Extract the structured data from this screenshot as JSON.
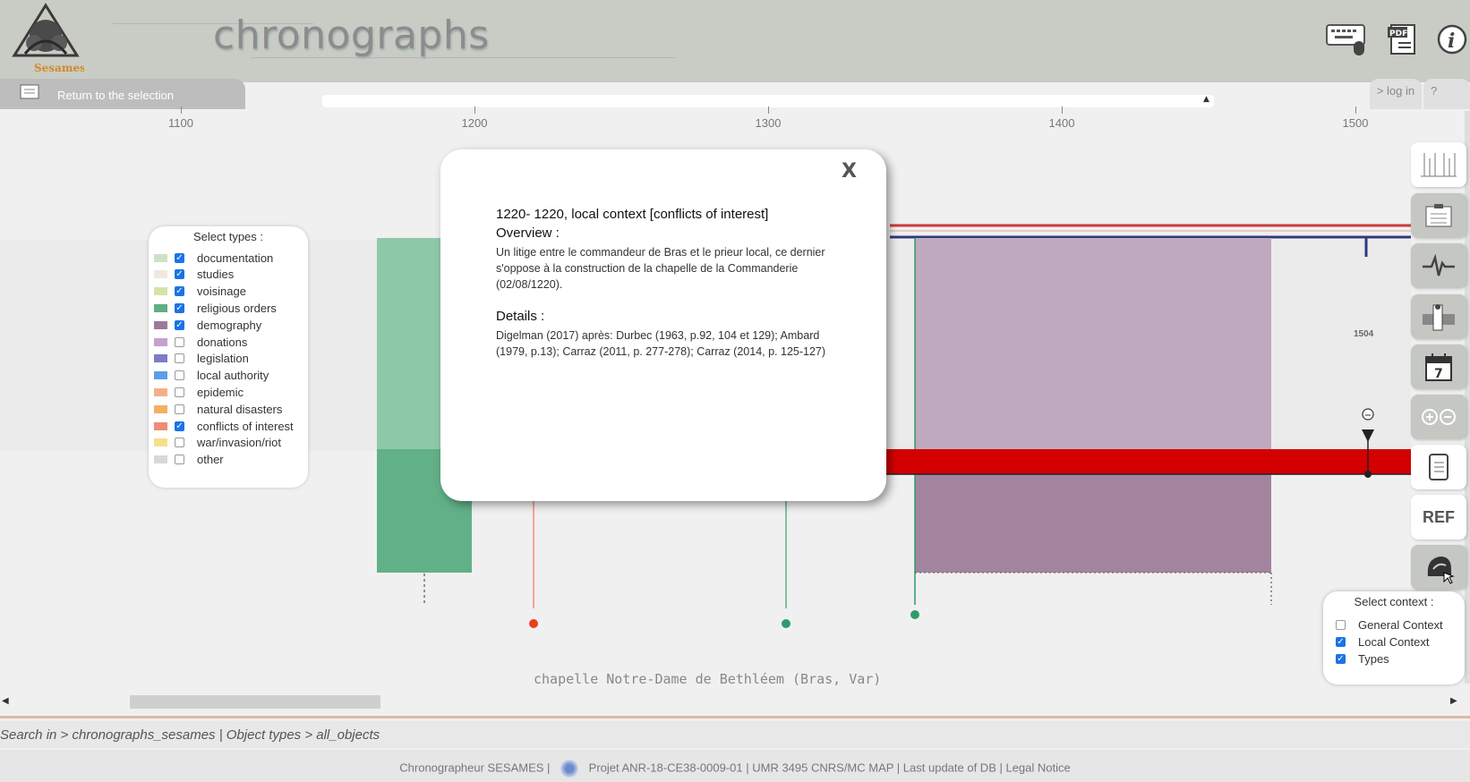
{
  "header": {
    "logo_text": "Sesames",
    "app_title": "chronographs",
    "return_label": "Return to the selection",
    "login_tab": "> log in",
    "help_tab": "?"
  },
  "axis": {
    "ticks": [
      "1100",
      "1200",
      "1300",
      "1400",
      "1500"
    ]
  },
  "types_panel": {
    "title": "Select types :",
    "items": [
      {
        "label": "documentation",
        "color": "#cfe2c8",
        "checked": true
      },
      {
        "label": "studies",
        "color": "#efe8e0",
        "checked": true
      },
      {
        "label": "voisinage",
        "color": "#d4e4a8",
        "checked": true
      },
      {
        "label": "religious orders",
        "color": "#5fae85",
        "checked": true
      },
      {
        "label": "demography",
        "color": "#9a7a9a",
        "checked": true
      },
      {
        "label": "donations",
        "color": "#c7a0cf",
        "checked": false
      },
      {
        "label": "legislation",
        "color": "#7c7cc6",
        "checked": false
      },
      {
        "label": "local authority",
        "color": "#5b9ee8",
        "checked": false
      },
      {
        "label": "epidemic",
        "color": "#f2b08a",
        "checked": false
      },
      {
        "label": "natural disasters",
        "color": "#f2b062",
        "checked": false
      },
      {
        "label": "conflicts of interest",
        "color": "#ee8c7a",
        "checked": true
      },
      {
        "label": "war/invasion/riot",
        "color": "#f5e08a",
        "checked": false
      },
      {
        "label": "other",
        "color": "#d8d8d8",
        "checked": false
      }
    ]
  },
  "modal": {
    "close_label": "X",
    "heading": "1220- 1220, local context [conflicts of interest]",
    "overview_heading": "Overview :",
    "overview_text": "Un litige entre le commandeur de Bras et le prieur local, ce dernier s'oppose à la construction de la chapelle de la Commanderie (02/08/1220).",
    "details_heading": "Details :",
    "details_text": "Digelman (2017) après: Durbec (1963, p.92, 104 et 129); Ambard (1979, p.13); Carraz (2011, p. 277-278); Carraz (2014, p. 125-127)"
  },
  "timeline": {
    "marker_label": "1504",
    "caption": "chapelle Notre-Dame de Bethléem (Bras, Var)",
    "colors": {
      "religious_orders_light": "#8dc9a9",
      "religious_orders_dark": "#62b087",
      "demography_light": "#bfa9bf",
      "demography_dark": "#a3849f",
      "conflict_bar": "#d40000",
      "context_red": "#cc3a3a",
      "context_navy": "#2f3a7a",
      "dot_red": "#e8401c",
      "dot_green": "#2e9c6a"
    }
  },
  "tools": {
    "ref_label": "REF",
    "calendar_day": "7"
  },
  "context_panel": {
    "title": "Select context :",
    "items": [
      {
        "label": "General Context",
        "checked": false
      },
      {
        "label": "Local Context",
        "checked": true
      },
      {
        "label": "Types",
        "checked": true
      }
    ]
  },
  "footer": {
    "breadcrumb": "Search in > chronographs_sesames | Object types > all_objects",
    "left_text": "Chronographeur SESAMES |",
    "right_text": "Projet ANR-18-CE38-0009-01 | UMR 3495 CNRS/MC MAP | Last update of DB | Legal Notice"
  }
}
